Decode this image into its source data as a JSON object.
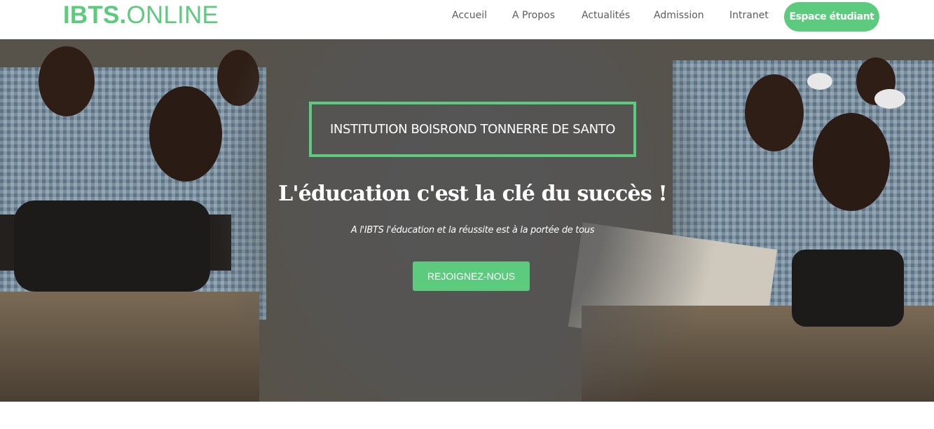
{
  "brand": {
    "bold": "IBTS.",
    "rest": "ONLINE"
  },
  "nav": {
    "items": [
      {
        "label": "Accueil"
      },
      {
        "label": "A Propos"
      },
      {
        "label": "Actualités"
      },
      {
        "label": "Admission"
      },
      {
        "label": "Intranet"
      }
    ],
    "cta_label": "Espace étudiant"
  },
  "hero": {
    "title": "INSTITUTION BOISROND TONNERRE DE SANTO",
    "heading": "L'éducation c'est la clé du succès !",
    "subheading": "A l'IBTS l'éducation et la réussite est à la portée de tous",
    "button_label": "REJOIGNEZ-NOUS"
  },
  "colors": {
    "accent": "#5ccb7e",
    "nav_text": "#5c5c5c",
    "hero_overlay": "#555555"
  }
}
